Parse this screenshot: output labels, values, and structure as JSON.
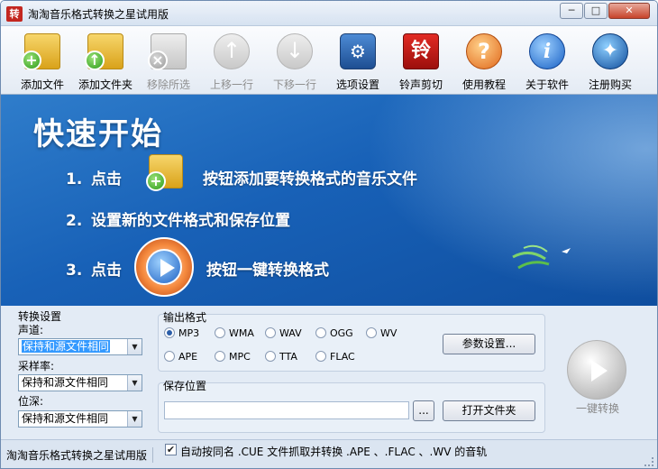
{
  "window": {
    "title": "淘淘音乐格式转换之星试用版",
    "app_icon": "转"
  },
  "window_controls": {
    "minimize": "─",
    "maximize": "□",
    "close": "✕"
  },
  "toolbar": [
    {
      "key": "add-file",
      "label": "添加文件",
      "icon": "add-file-icon",
      "enabled": true
    },
    {
      "key": "add-folder",
      "label": "添加文件夹",
      "icon": "add-folder-icon",
      "enabled": true
    },
    {
      "key": "remove-selected",
      "label": "移除所选",
      "icon": "remove-icon",
      "enabled": false
    },
    {
      "key": "move-up",
      "label": "上移一行",
      "icon": "arrow-up-icon",
      "enabled": false
    },
    {
      "key": "move-down",
      "label": "下移一行",
      "icon": "arrow-down-icon",
      "enabled": false
    },
    {
      "key": "options",
      "label": "选项设置",
      "icon": "settings-icon",
      "enabled": true
    },
    {
      "key": "ringtone",
      "label": "铃声剪切",
      "icon": "ringtone-icon",
      "enabled": true,
      "glyph": "铃"
    },
    {
      "key": "help",
      "label": "使用教程",
      "icon": "help-icon",
      "enabled": true,
      "glyph": "?"
    },
    {
      "key": "about",
      "label": "关于软件",
      "icon": "info-icon",
      "enabled": true,
      "glyph": "i"
    },
    {
      "key": "register",
      "label": "注册购买",
      "icon": "globe-icon",
      "enabled": true
    }
  ],
  "banner": {
    "title": "快速开始",
    "steps": [
      {
        "num": "1.",
        "prefix": "点击",
        "text": "按钮添加要转换格式的音乐文件"
      },
      {
        "num": "2.",
        "text": "设置新的文件格式和保存位置"
      },
      {
        "num": "3.",
        "prefix": "点击",
        "text": "按钮一键转换格式"
      }
    ]
  },
  "convert_settings": {
    "heading": "转换设置",
    "channel": {
      "label": "声道:",
      "value": "保持和源文件相同"
    },
    "sample_rate": {
      "label": "采样率:",
      "value": "保持和源文件相同"
    },
    "bit_depth": {
      "label": "位深:",
      "value": "保持和源文件相同"
    }
  },
  "output_format": {
    "heading": "输出格式",
    "formats": [
      "MP3",
      "WMA",
      "WAV",
      "OGG",
      "WV",
      "APE",
      "MPC",
      "TTA",
      "FLAC"
    ],
    "selected": "MP3",
    "params_button": "参数设置..."
  },
  "save_location": {
    "heading": "保存位置",
    "path": "",
    "browse_button": "...",
    "open_folder_button": "打开文件夹"
  },
  "one_click_convert": {
    "label": "一键转换",
    "enabled": false
  },
  "statusbar": {
    "app_name": "淘淘音乐格式转换之星试用版",
    "checkbox_checked": true,
    "checkbox_label": "自动按同名 .CUE 文件抓取并转换 .APE 、.FLAC 、.WV 的音轨"
  }
}
